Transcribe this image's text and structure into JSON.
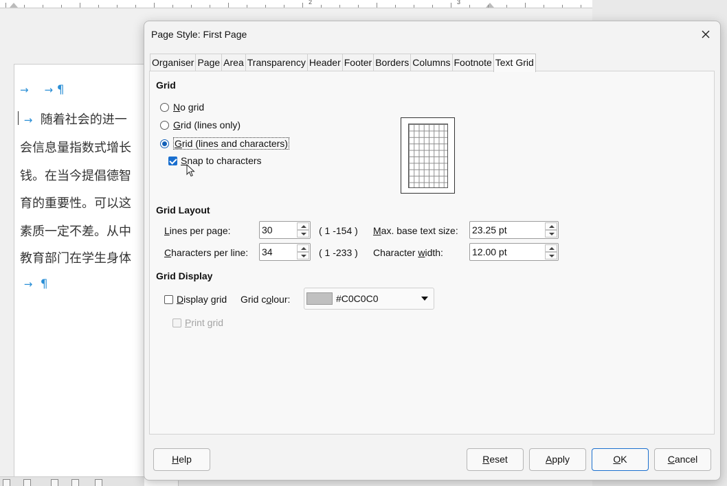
{
  "ruler": {
    "numbers": [
      "2",
      "3"
    ]
  },
  "document": {
    "lines": [
      {
        "arrows": [
          "→",
          "→"
        ],
        "text": "",
        "pilcrow": "¶"
      },
      {
        "arrows": [
          "→"
        ],
        "text": "随着社会的进一",
        "pilcrow": ""
      },
      {
        "arrows": [],
        "text": "会信息量指数式增长",
        "pilcrow": ""
      },
      {
        "arrows": [],
        "text": "钱。在当今提倡德智",
        "pilcrow": ""
      },
      {
        "arrows": [],
        "text": "育的重要性。可以这",
        "pilcrow": ""
      },
      {
        "arrows": [],
        "text": "素质一定不差。从中",
        "pilcrow": ""
      },
      {
        "arrows": [],
        "text": "教育部门在学生身体",
        "pilcrow": ""
      },
      {
        "arrows": [
          "→"
        ],
        "text": "",
        "pilcrow": "¶"
      }
    ]
  },
  "dialog": {
    "title": "Page Style: First Page",
    "close_icon": "close-icon",
    "tabs": [
      {
        "label": "Organiser",
        "active": false
      },
      {
        "label": "Page",
        "active": false
      },
      {
        "label": "Area",
        "active": false
      },
      {
        "label": "Transparency",
        "active": false
      },
      {
        "label": "Header",
        "active": false
      },
      {
        "label": "Footer",
        "active": false
      },
      {
        "label": "Borders",
        "active": false
      },
      {
        "label": "Columns",
        "active": false
      },
      {
        "label": "Footnote",
        "active": false
      },
      {
        "label": "Text Grid",
        "active": true
      }
    ],
    "grid": {
      "heading": "Grid",
      "options": [
        {
          "mnemonic": "N",
          "rest": "o grid",
          "checked": false
        },
        {
          "mnemonic": "G",
          "rest": "rid (lines only)",
          "checked": false
        },
        {
          "mnemonic": "G",
          "rest": "rid (lines and characters)",
          "checked": true
        }
      ],
      "snap": {
        "mnemonic": "S",
        "rest": "nap to characters",
        "checked": true
      }
    },
    "layout": {
      "heading": "Grid Layout",
      "lines_per_page": {
        "mnemonic": "L",
        "rest": "ines per page:",
        "value": "30",
        "range": "( 1 -154 )"
      },
      "chars_per_line": {
        "mnemonic": "C",
        "rest": "haracters per line:",
        "value": "34",
        "range": "( 1 -233 )"
      },
      "max_base": {
        "mnemonic": "M",
        "rest": "ax. base text size:",
        "value": "23.25 pt"
      },
      "char_width": {
        "pre": "Character ",
        "mnemonic": "w",
        "rest": "idth:",
        "value": "12.00 pt"
      }
    },
    "display": {
      "heading": "Grid Display",
      "display_grid": {
        "mnemonic": "D",
        "rest": "isplay grid",
        "checked": false
      },
      "grid_colour_label": {
        "pre": "Grid c",
        "mnemonic": "o",
        "rest": "lour:"
      },
      "grid_colour_value": "#C0C0C0",
      "grid_colour_hex": "#C0C0C0",
      "print_grid": {
        "mnemonic": "P",
        "rest": "rint grid",
        "checked": false,
        "disabled": true
      }
    },
    "buttons": {
      "help": {
        "mnemonic": "H",
        "rest": "elp"
      },
      "reset": {
        "mnemonic": "R",
        "rest": "eset"
      },
      "apply": {
        "mnemonic": "A",
        "rest": "pply"
      },
      "ok": {
        "mnemonic": "O",
        "rest": "K"
      },
      "cancel": {
        "mnemonic": "C",
        "rest": "ancel"
      }
    }
  }
}
